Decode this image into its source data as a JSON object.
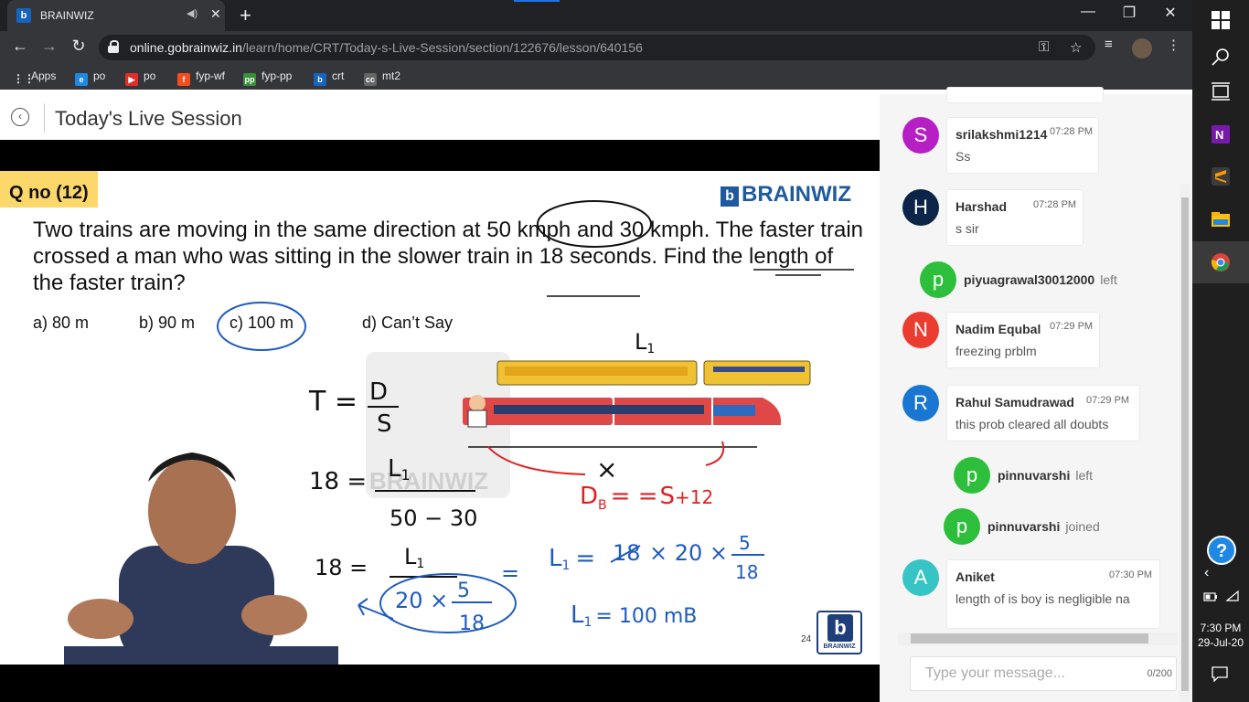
{
  "browser": {
    "tab_title": "BRAINWIZ",
    "url_host": "online.gobrainwiz.in",
    "url_path": "/learn/home/CRT/Today-s-Live-Session/section/122676/lesson/640156",
    "bookmarks": [
      "Apps",
      "po",
      "po",
      "fyp-wf",
      "fyp-pp",
      "crt",
      "mt2"
    ]
  },
  "page": {
    "title": "Today's Live Session"
  },
  "slide": {
    "qno": "Q no (12)",
    "logo": "BRAINWIZ",
    "question": "Two trains are moving in the same direction at 50 kmph and 30 kmph. The faster train crossed a man who was sitting in the slower train in 18 seconds. Find the length of the faster train?",
    "options": [
      "a) 80 m",
      "b) 90 m",
      "c) 100 m",
      "d) Can’t Say"
    ],
    "slide_number": "24",
    "corner_logo": "BRAINWIZ",
    "watermark": "BRAINWIZ",
    "handwriting": {
      "l1_top": "L",
      "l1_top_sub": "1",
      "t_eq": "T =",
      "t_num": "D",
      "t_den": "S",
      "eq1_lhs": "18 =",
      "eq1_num": "L",
      "eq1_num_sub": "1",
      "eq1_den": "50 − 30",
      "eq2_lhs": "18 =",
      "eq2_num": "L",
      "eq2_num_sub": "1",
      "eq2_circled": "20 ×",
      "eq2_frac_num": "5",
      "eq2_frac_den": "18",
      "equals": "=",
      "rhs1": "L",
      "rhs1_sub": "1",
      "rhs1_eq": "=",
      "rhs1_18": "18",
      "rhs1_mid": "× 20 ×",
      "rhs1_frac_num": "5",
      "rhs1_frac_den": "18",
      "rhs2": "L",
      "rhs2_sub": "1",
      "rhs2_eq": "= 100 mB",
      "x_mark": "×",
      "red_d": "D",
      "red_sub": "B",
      "red_eq": "= =",
      "red_s": "S",
      "red_tail": "+12"
    }
  },
  "chat": {
    "messages": [
      {
        "initial": "S",
        "name": "srilakshmi1214",
        "time": "07:28 PM",
        "text": "Ss",
        "color": "#b51fc4"
      },
      {
        "initial": "H",
        "name": "Harshad",
        "time": "07:28 PM",
        "text": "s sir",
        "color": "#0b2447"
      },
      {
        "initial": "N",
        "name": "Nadim Equbal",
        "time": "07:29 PM",
        "text": "freezing prblm",
        "color": "#ea3c2f"
      },
      {
        "initial": "R",
        "name": "Rahul Samudrawad",
        "time": "07:29 PM",
        "text": "this prob cleared all doubts",
        "color": "#1976d2"
      },
      {
        "initial": "A",
        "name": "Aniket",
        "time": "07:30 PM",
        "text": "length of is boy is negligible na",
        "color": "#36c4c4"
      }
    ],
    "system": [
      {
        "initial": "p",
        "name": "piyuagrawal30012000",
        "status": "left"
      },
      {
        "initial": "p",
        "name": "pinnuvarshi",
        "status": "left"
      },
      {
        "initial": "p",
        "name": "pinnuvarshi",
        "status": "joined"
      }
    ],
    "input_placeholder": "Type your message...",
    "char_count": "0/200"
  },
  "taskbar": {
    "time": "7:30 PM",
    "date": "29-Jul-20"
  },
  "colors": {
    "accent_green": "#2dbf3b",
    "chrome_dark": "#202124",
    "chrome_mid": "#35363a",
    "highlight_yellow": "#fcd86b",
    "brand_blue": "#1f5a9e"
  }
}
